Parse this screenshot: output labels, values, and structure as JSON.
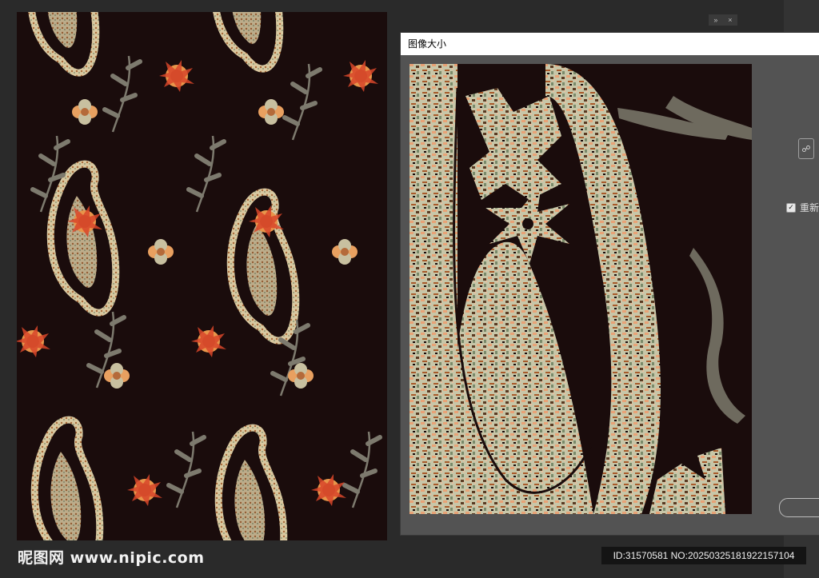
{
  "dialog": {
    "title": "图像大小",
    "resample_label": "重新",
    "resample_checked": true,
    "link_icon": "chain-link-icon"
  },
  "panel": {
    "collapse_icon": "»",
    "close_icon": "×"
  },
  "watermark": {
    "site_text": "昵图网 www.nipic.com",
    "id_text": "ID:31570581 NO:20250325181922157104"
  },
  "colors": {
    "background": "#1a0c0c",
    "paisley_cream": "#d9c8a0",
    "flower_orange": "#e8954a",
    "flower_red": "#d8462a",
    "leaf_gray": "#7d7a6e",
    "dialog_gray": "#535353"
  }
}
